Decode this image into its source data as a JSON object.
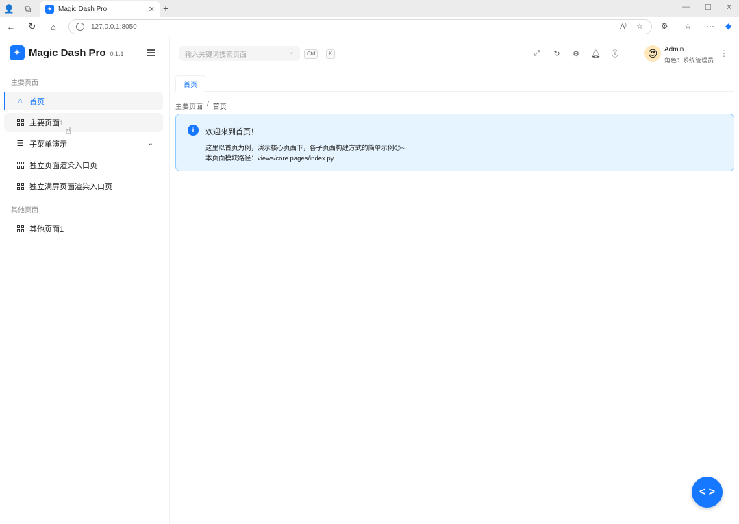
{
  "browser": {
    "tab_title": "Magic Dash Pro",
    "url": "127.0.0.1:8050"
  },
  "app": {
    "logo_title": "Magic Dash Pro",
    "logo_version": "0.1.1"
  },
  "sidebar": {
    "group_main": "主要页面",
    "group_other": "其他页面",
    "items": [
      {
        "label": "首页",
        "icon": "home-icon"
      },
      {
        "label": "主要页面1",
        "icon": "grid-icon"
      },
      {
        "label": "子菜单演示",
        "icon": "list-icon"
      },
      {
        "label": "独立页面渲染入口页",
        "icon": "grid-icon"
      },
      {
        "label": "独立满屏页面渲染入口页",
        "icon": "grid-icon"
      },
      {
        "label": "其他页面1",
        "icon": "grid-icon"
      }
    ]
  },
  "header": {
    "search_placeholder": "输入关键词搜索页面",
    "kbd_ctrl": "Ctrl",
    "kbd_k": "K",
    "user_name": "Admin",
    "user_role": "角色：系统管理员"
  },
  "tabs": [
    {
      "label": "首页"
    }
  ],
  "breadcrumb": {
    "parent": "主要页面",
    "separator": "/",
    "current": "首页"
  },
  "alert": {
    "title": "欢迎来到首页！",
    "line1": "这里以首页为例，演示核心页面下，各子页面构建方式的简单示例😊~",
    "line2_prefix": "本页面模块路径：",
    "line2_path": "views/core pages/index.py"
  },
  "colors": {
    "accent": "#1677ff",
    "alert_bg": "#e6f4ff",
    "alert_border": "#91caff"
  }
}
